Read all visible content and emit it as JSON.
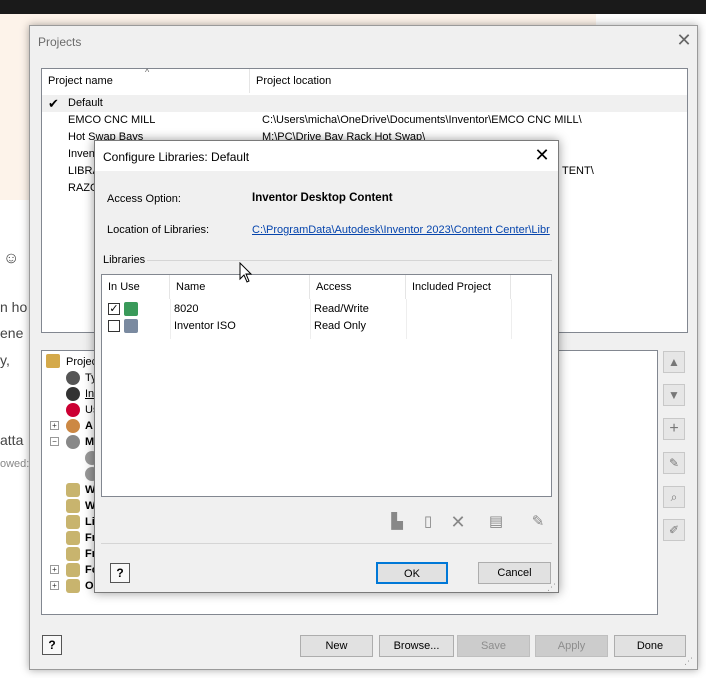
{
  "background": {
    "texts": [
      "☺",
      "n ho",
      "ene",
      "y,",
      "atta",
      "owed:"
    ]
  },
  "projects_dialog": {
    "title": "Projects",
    "columns": [
      "Project name",
      "Project location"
    ],
    "rows": [
      {
        "name": "Default",
        "location": "",
        "checked": true
      },
      {
        "name": "EMCO CNC MILL",
        "location": "C:\\Users\\micha\\OneDrive\\Documents\\Inventor\\EMCO CNC MILL\\",
        "checked": false
      },
      {
        "name": "Hot Swap Bays",
        "location": "M:\\PC\\Drive Bay Rack Hot Swap\\",
        "checked": false
      },
      {
        "name": "Inven",
        "location": "",
        "checked": false
      },
      {
        "name": "LIBRA",
        "location": "TENT\\",
        "checked": false
      },
      {
        "name": "RAZO",
        "location": "",
        "checked": false
      }
    ],
    "tree": [
      {
        "label": "Projec",
        "bold": false,
        "underline": false
      },
      {
        "label": "Ty",
        "bold": false,
        "underline": false
      },
      {
        "label": "In",
        "bold": false,
        "underline": true
      },
      {
        "label": "Us",
        "bold": false,
        "underline": false
      },
      {
        "label": "A",
        "bold": true,
        "underline": false
      },
      {
        "label": "M",
        "bold": true,
        "underline": false
      },
      {
        "label": "",
        "bold": false,
        "underline": false
      },
      {
        "label": "",
        "bold": false,
        "underline": false
      },
      {
        "label": "W",
        "bold": true,
        "underline": false
      },
      {
        "label": "W",
        "bold": true,
        "underline": false
      },
      {
        "label": "Li",
        "bold": true,
        "underline": false
      },
      {
        "label": "Fr",
        "bold": true,
        "underline": false
      },
      {
        "label": "Fr",
        "bold": true,
        "underline": false
      },
      {
        "label": "Fo",
        "bold": true,
        "underline": false
      },
      {
        "label": "O",
        "bold": true,
        "underline": false
      }
    ],
    "buttons": {
      "help": "?",
      "new": "New",
      "browse": "Browse...",
      "save": "Save",
      "apply": "Apply",
      "done": "Done"
    }
  },
  "configure_dialog": {
    "title": "Configure Libraries: Default",
    "access_option_label": "Access Option:",
    "access_option_value": "Inventor Desktop Content",
    "location_label": "Location of Libraries:",
    "location_value": "C:\\ProgramData\\Autodesk\\Inventor 2023\\Content Center\\Libr",
    "libraries_label": "Libraries",
    "columns": [
      "In Use",
      "Name",
      "Access",
      "Included Project"
    ],
    "libraries": [
      {
        "in_use": true,
        "name": "8020",
        "access": "Read/Write",
        "included_project": ""
      },
      {
        "in_use": false,
        "name": "Inventor ISO",
        "access": "Read Only",
        "included_project": ""
      }
    ],
    "buttons": {
      "help": "?",
      "ok": "OK",
      "cancel": "Cancel"
    },
    "link_color": "#0645ad"
  }
}
